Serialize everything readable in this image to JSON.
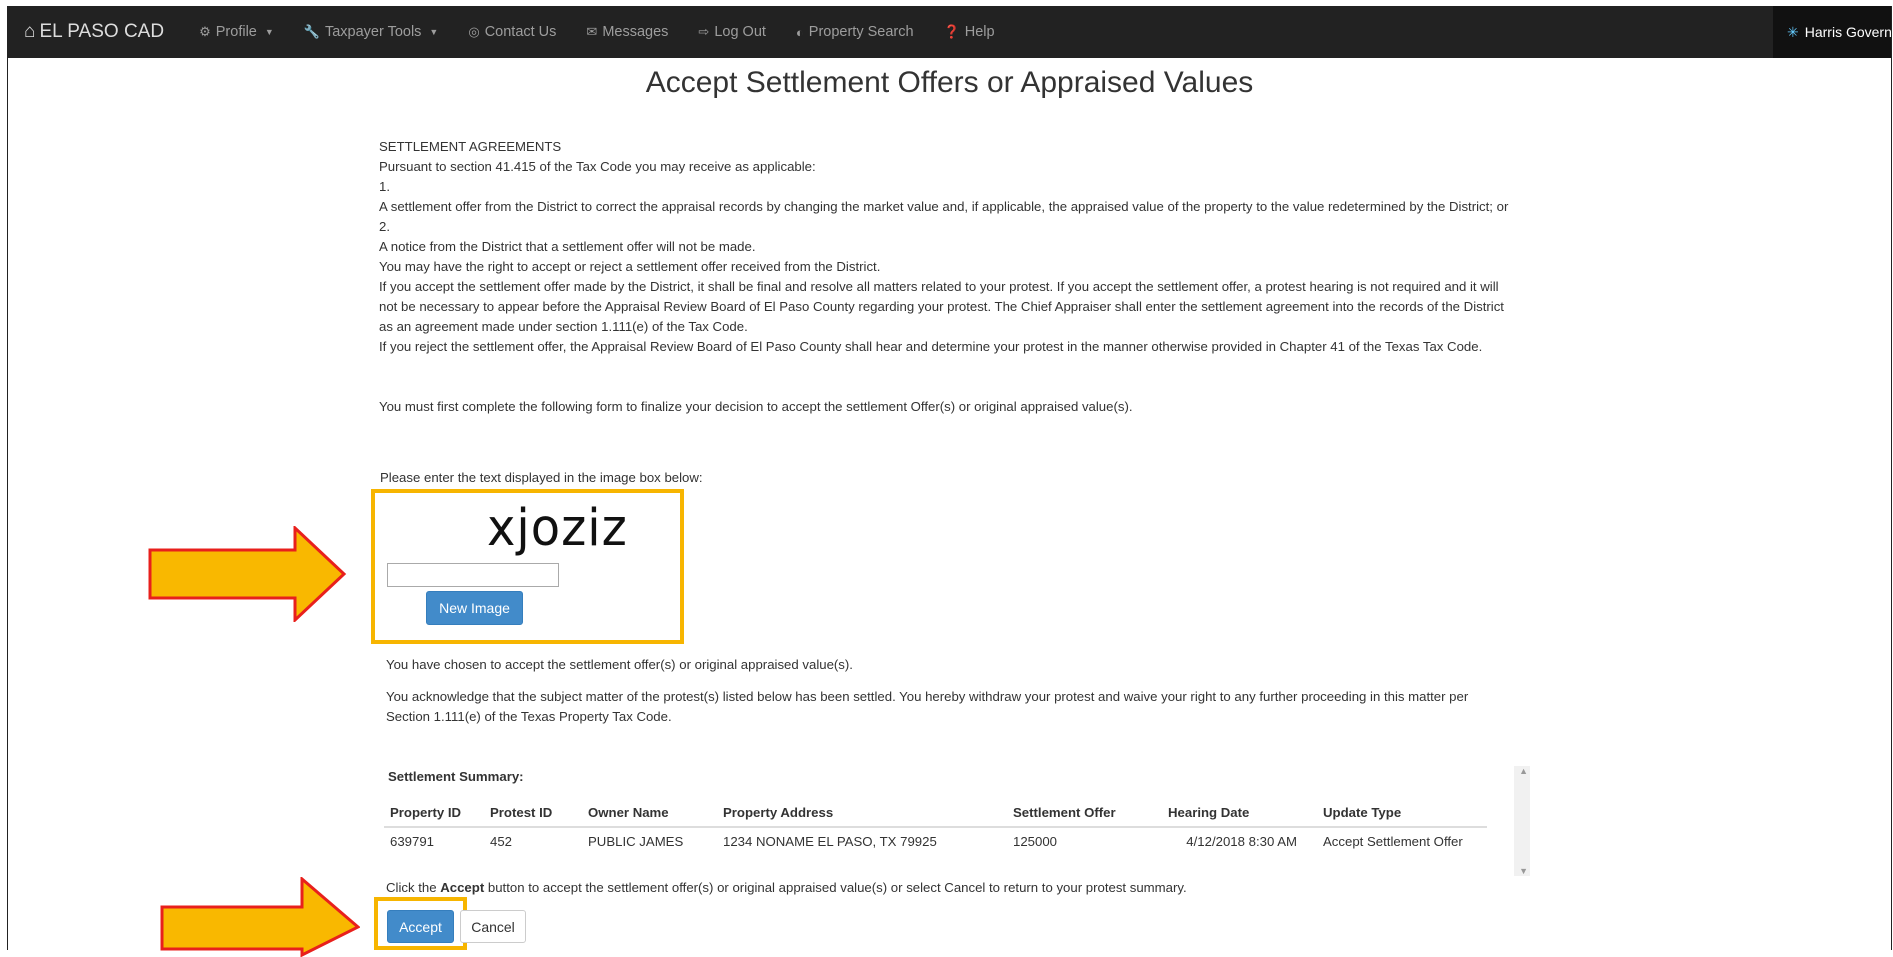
{
  "navbar": {
    "brand": "EL PASO CAD",
    "items": [
      {
        "label": "Profile",
        "icon": "gears-icon",
        "dropdown": true
      },
      {
        "label": "Taxpayer Tools",
        "icon": "wrench-icon",
        "dropdown": true
      },
      {
        "label": "Contact Us",
        "icon": "lifebuoy-icon",
        "dropdown": false
      },
      {
        "label": "Messages",
        "icon": "envelope-icon",
        "dropdown": false
      },
      {
        "label": "Log Out",
        "icon": "logout-icon",
        "dropdown": false
      },
      {
        "label": "Property Search",
        "icon": "globe-icon",
        "dropdown": false
      },
      {
        "label": "Help",
        "icon": "question-icon",
        "dropdown": false
      }
    ],
    "right_label": "Harris Govern"
  },
  "page": {
    "title": "Accept Settlement Offers or Appraised Values"
  },
  "agreement": {
    "heading": "SETTLEMENT AGREEMENTS",
    "intro": "Pursuant to section 41.415 of the Tax Code you may receive as applicable:",
    "item1_num": "1.",
    "item1_text": "A settlement offer from the District to correct the appraisal records by changing the market value and, if applicable, the appraised value of the property to the value redetermined by the District; or",
    "item2_num": "2.",
    "item2_text": "A notice from the District that a settlement offer will not be made.",
    "right_text": "You may have the right to accept or reject a settlement offer received from the District.",
    "accept_text": "If you accept the settlement offer made by the District, it shall be final and resolve all matters related to your protest. If you accept the settlement offer, a protest hearing is not required and it will not be necessary to appear before the Appraisal Review Board of El Paso County regarding your protest. The Chief Appraiser shall enter the settlement agreement into the records of the District as an agreement made under section 1.111(e) of the Tax Code.",
    "reject_text": "If you reject the settlement offer, the Appraisal Review Board of El Paso County shall hear and determine your protest in the manner otherwise provided in Chapter 41 of the Texas Tax Code."
  },
  "form": {
    "intro": "You must first complete the following form to finalize your decision to accept the settlement Offer(s) or original appraised value(s).",
    "captcha_label": "Please enter the text displayed in the image box below:",
    "captcha_text": "xjoziz",
    "captcha_value": "",
    "new_image_label": "New Image",
    "ack1": "You have chosen to accept the settlement offer(s) or original appraised value(s).",
    "ack2": "You acknowledge that the subject matter of the protest(s) listed below has been settled. You hereby withdraw your protest and waive your right to any further proceeding in this matter per Section 1.111(e) of the Texas Property Tax Code."
  },
  "summary": {
    "title": "Settlement Summary:",
    "columns": [
      "Property ID",
      "Protest ID",
      "Owner Name",
      "Property Address",
      "Settlement Offer",
      "Hearing Date",
      "Update Type"
    ],
    "rows": [
      [
        "639791",
        "452",
        "PUBLIC JAMES",
        "1234 NONAME EL PASO, TX 79925",
        "125000",
        "4/12/2018 8:30 AM",
        "Accept Settlement Offer"
      ]
    ]
  },
  "footer": {
    "click_pre": "Click the ",
    "click_bold": "Accept",
    "click_post": " button to accept the settlement offer(s) or original appraised value(s) or select Cancel to return to your protest summary.",
    "accept_label": "Accept",
    "cancel_label": "Cancel"
  },
  "colors": {
    "navbar_bg": "#222222",
    "highlight": "#f7b500",
    "arrow_fill": "#f9b800",
    "arrow_stroke": "#e8201c",
    "primary": "#428bca"
  }
}
